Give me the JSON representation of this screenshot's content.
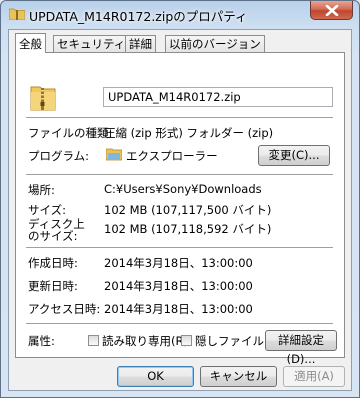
{
  "window": {
    "title": "UPDATA_M14R0172.zipのプロパティ",
    "close_label": "×"
  },
  "tabs": [
    "全般",
    "セキュリティ",
    "詳細",
    "以前のバージョン"
  ],
  "general": {
    "file_name": "UPDATA_M14R0172.zip",
    "type_label": "ファイルの種類:",
    "type_value": "圧縮 (zip 形式) フォルダー (zip)",
    "program_label": "プログラム:",
    "program_value": "エクスプローラー",
    "change_button": "変更(C)...",
    "location_label": "場所:",
    "location_value": "C:¥Users¥Sony¥Downloads",
    "size_label": "サイズ:",
    "size_value": "102 MB (107,117,500 バイト)",
    "disk_size_label_1": "ディスク上",
    "disk_size_label_2": "のサイズ:",
    "disk_size_value": "102 MB (107,118,592 バイト)",
    "created_label": "作成日時:",
    "created_value": "2014年3月18日、13:00:00",
    "modified_label": "更新日時:",
    "modified_value": "2014年3月18日、13:00:00",
    "accessed_label": "アクセス日時:",
    "accessed_value": "2014年3月18日、13:00:00",
    "attributes_label": "属性:",
    "readonly_label": "読み取り専用(R)",
    "hidden_label": "隠しファイル(H)",
    "advanced_button": "詳細設定(D)..."
  },
  "footer": {
    "ok": "OK",
    "cancel": "キャンセル",
    "apply": "適用(A)"
  },
  "colors": {
    "title_gradient_top": "#b8d0ea",
    "close_red": "#c0462f",
    "panel": "#ffffff"
  }
}
